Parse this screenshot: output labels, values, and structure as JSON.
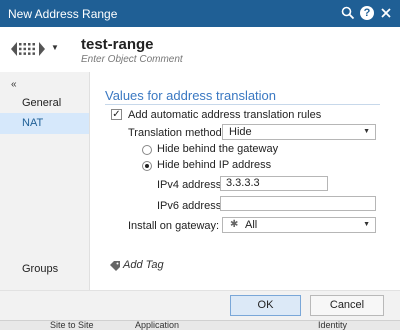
{
  "window": {
    "title": "New Address Range",
    "colors": {
      "titlebar": "#1f5f95",
      "accent": "#3a78c2",
      "selected_nav": "#d6e8fb"
    },
    "icons": [
      "search-icon",
      "help-icon",
      "close-icon"
    ]
  },
  "object": {
    "name": "test-range",
    "comment_placeholder": "Enter Object Comment",
    "icon": "address-range-icon"
  },
  "sidebar": {
    "collapse_icon": "«",
    "items": [
      {
        "label": "General"
      },
      {
        "label": "NAT",
        "active": true
      }
    ],
    "bottom_item": "Groups"
  },
  "nat": {
    "section_title": "Values for address translation",
    "auto_rules": {
      "label": "Add automatic address translation rules",
      "checked": true,
      "mark": "✓"
    },
    "method": {
      "label": "Translation method:",
      "value": "Hide"
    },
    "hide_gateway": {
      "label": "Hide behind the gateway",
      "selected": false
    },
    "hide_ip": {
      "label": "Hide behind IP address",
      "selected": true
    },
    "ipv4": {
      "label": "IPv4 address:",
      "value": "3.3.3.3"
    },
    "ipv6": {
      "label": "IPv6 address:",
      "value": ""
    },
    "install_on": {
      "label": "Install on gateway:",
      "value": "All"
    }
  },
  "tags": {
    "label": "Add Tag"
  },
  "footer": {
    "ok_label": "OK",
    "cancel_label": "Cancel"
  },
  "taskbar": {
    "items": [
      "Site to Site",
      "Application",
      "Identity"
    ]
  }
}
